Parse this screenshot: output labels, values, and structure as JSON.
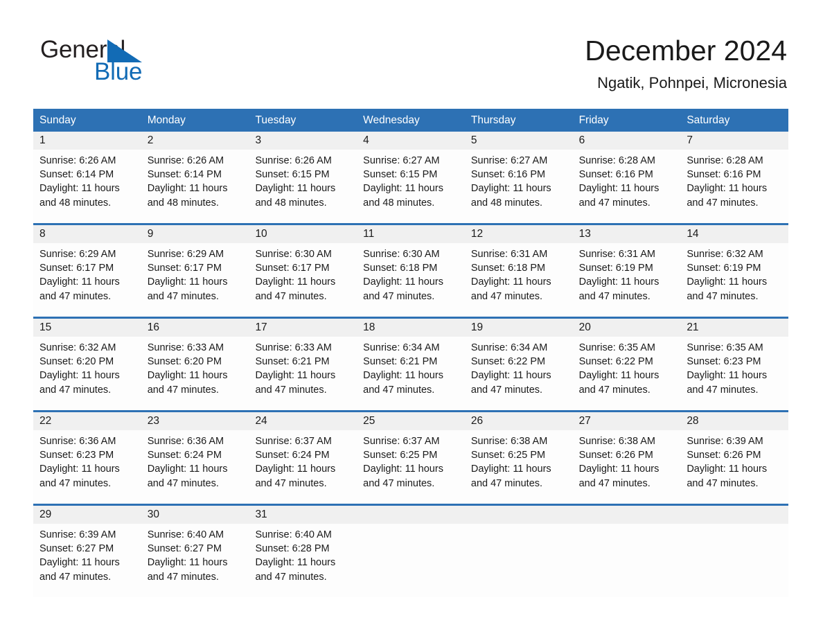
{
  "brand": {
    "name_part1": "General",
    "name_part2": "Blue",
    "triangle_color": "#126bb5",
    "icon": "triangle-logo-icon"
  },
  "header": {
    "month_title": "December 2024",
    "location": "Ngatik, Pohnpei, Micronesia"
  },
  "theme": {
    "header_blue": "#2d71b4",
    "day_strip_gray": "#f0f0f0",
    "text": "#1a1a1a",
    "brand_blue": "#126bb5"
  },
  "weekdays": [
    "Sunday",
    "Monday",
    "Tuesday",
    "Wednesday",
    "Thursday",
    "Friday",
    "Saturday"
  ],
  "weeks": [
    [
      {
        "day": "1",
        "sunrise": "Sunrise: 6:26 AM",
        "sunset": "Sunset: 6:14 PM",
        "daylight": "Daylight: 11 hours and 48 minutes."
      },
      {
        "day": "2",
        "sunrise": "Sunrise: 6:26 AM",
        "sunset": "Sunset: 6:14 PM",
        "daylight": "Daylight: 11 hours and 48 minutes."
      },
      {
        "day": "3",
        "sunrise": "Sunrise: 6:26 AM",
        "sunset": "Sunset: 6:15 PM",
        "daylight": "Daylight: 11 hours and 48 minutes."
      },
      {
        "day": "4",
        "sunrise": "Sunrise: 6:27 AM",
        "sunset": "Sunset: 6:15 PM",
        "daylight": "Daylight: 11 hours and 48 minutes."
      },
      {
        "day": "5",
        "sunrise": "Sunrise: 6:27 AM",
        "sunset": "Sunset: 6:16 PM",
        "daylight": "Daylight: 11 hours and 48 minutes."
      },
      {
        "day": "6",
        "sunrise": "Sunrise: 6:28 AM",
        "sunset": "Sunset: 6:16 PM",
        "daylight": "Daylight: 11 hours and 47 minutes."
      },
      {
        "day": "7",
        "sunrise": "Sunrise: 6:28 AM",
        "sunset": "Sunset: 6:16 PM",
        "daylight": "Daylight: 11 hours and 47 minutes."
      }
    ],
    [
      {
        "day": "8",
        "sunrise": "Sunrise: 6:29 AM",
        "sunset": "Sunset: 6:17 PM",
        "daylight": "Daylight: 11 hours and 47 minutes."
      },
      {
        "day": "9",
        "sunrise": "Sunrise: 6:29 AM",
        "sunset": "Sunset: 6:17 PM",
        "daylight": "Daylight: 11 hours and 47 minutes."
      },
      {
        "day": "10",
        "sunrise": "Sunrise: 6:30 AM",
        "sunset": "Sunset: 6:17 PM",
        "daylight": "Daylight: 11 hours and 47 minutes."
      },
      {
        "day": "11",
        "sunrise": "Sunrise: 6:30 AM",
        "sunset": "Sunset: 6:18 PM",
        "daylight": "Daylight: 11 hours and 47 minutes."
      },
      {
        "day": "12",
        "sunrise": "Sunrise: 6:31 AM",
        "sunset": "Sunset: 6:18 PM",
        "daylight": "Daylight: 11 hours and 47 minutes."
      },
      {
        "day": "13",
        "sunrise": "Sunrise: 6:31 AM",
        "sunset": "Sunset: 6:19 PM",
        "daylight": "Daylight: 11 hours and 47 minutes."
      },
      {
        "day": "14",
        "sunrise": "Sunrise: 6:32 AM",
        "sunset": "Sunset: 6:19 PM",
        "daylight": "Daylight: 11 hours and 47 minutes."
      }
    ],
    [
      {
        "day": "15",
        "sunrise": "Sunrise: 6:32 AM",
        "sunset": "Sunset: 6:20 PM",
        "daylight": "Daylight: 11 hours and 47 minutes."
      },
      {
        "day": "16",
        "sunrise": "Sunrise: 6:33 AM",
        "sunset": "Sunset: 6:20 PM",
        "daylight": "Daylight: 11 hours and 47 minutes."
      },
      {
        "day": "17",
        "sunrise": "Sunrise: 6:33 AM",
        "sunset": "Sunset: 6:21 PM",
        "daylight": "Daylight: 11 hours and 47 minutes."
      },
      {
        "day": "18",
        "sunrise": "Sunrise: 6:34 AM",
        "sunset": "Sunset: 6:21 PM",
        "daylight": "Daylight: 11 hours and 47 minutes."
      },
      {
        "day": "19",
        "sunrise": "Sunrise: 6:34 AM",
        "sunset": "Sunset: 6:22 PM",
        "daylight": "Daylight: 11 hours and 47 minutes."
      },
      {
        "day": "20",
        "sunrise": "Sunrise: 6:35 AM",
        "sunset": "Sunset: 6:22 PM",
        "daylight": "Daylight: 11 hours and 47 minutes."
      },
      {
        "day": "21",
        "sunrise": "Sunrise: 6:35 AM",
        "sunset": "Sunset: 6:23 PM",
        "daylight": "Daylight: 11 hours and 47 minutes."
      }
    ],
    [
      {
        "day": "22",
        "sunrise": "Sunrise: 6:36 AM",
        "sunset": "Sunset: 6:23 PM",
        "daylight": "Daylight: 11 hours and 47 minutes."
      },
      {
        "day": "23",
        "sunrise": "Sunrise: 6:36 AM",
        "sunset": "Sunset: 6:24 PM",
        "daylight": "Daylight: 11 hours and 47 minutes."
      },
      {
        "day": "24",
        "sunrise": "Sunrise: 6:37 AM",
        "sunset": "Sunset: 6:24 PM",
        "daylight": "Daylight: 11 hours and 47 minutes."
      },
      {
        "day": "25",
        "sunrise": "Sunrise: 6:37 AM",
        "sunset": "Sunset: 6:25 PM",
        "daylight": "Daylight: 11 hours and 47 minutes."
      },
      {
        "day": "26",
        "sunrise": "Sunrise: 6:38 AM",
        "sunset": "Sunset: 6:25 PM",
        "daylight": "Daylight: 11 hours and 47 minutes."
      },
      {
        "day": "27",
        "sunrise": "Sunrise: 6:38 AM",
        "sunset": "Sunset: 6:26 PM",
        "daylight": "Daylight: 11 hours and 47 minutes."
      },
      {
        "day": "28",
        "sunrise": "Sunrise: 6:39 AM",
        "sunset": "Sunset: 6:26 PM",
        "daylight": "Daylight: 11 hours and 47 minutes."
      }
    ],
    [
      {
        "day": "29",
        "sunrise": "Sunrise: 6:39 AM",
        "sunset": "Sunset: 6:27 PM",
        "daylight": "Daylight: 11 hours and 47 minutes."
      },
      {
        "day": "30",
        "sunrise": "Sunrise: 6:40 AM",
        "sunset": "Sunset: 6:27 PM",
        "daylight": "Daylight: 11 hours and 47 minutes."
      },
      {
        "day": "31",
        "sunrise": "Sunrise: 6:40 AM",
        "sunset": "Sunset: 6:28 PM",
        "daylight": "Daylight: 11 hours and 47 minutes."
      },
      {
        "day": "",
        "sunrise": "",
        "sunset": "",
        "daylight": ""
      },
      {
        "day": "",
        "sunrise": "",
        "sunset": "",
        "daylight": ""
      },
      {
        "day": "",
        "sunrise": "",
        "sunset": "",
        "daylight": ""
      },
      {
        "day": "",
        "sunrise": "",
        "sunset": "",
        "daylight": ""
      }
    ]
  ]
}
